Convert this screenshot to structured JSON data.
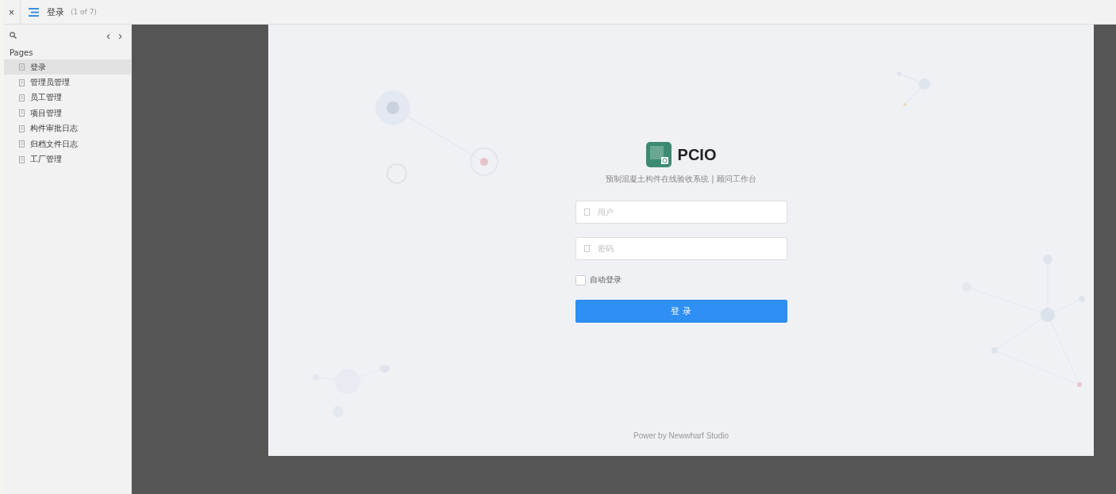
{
  "toolbar": {
    "close": "×",
    "page_title": "登录",
    "page_count": "(1 of 7)"
  },
  "sidebar": {
    "nav_prev": "‹",
    "nav_next": "›",
    "section_title": "Pages",
    "items": [
      {
        "label": "登录",
        "selected": true
      },
      {
        "label": "管理员管理",
        "selected": false
      },
      {
        "label": "员工管理",
        "selected": false
      },
      {
        "label": "项目管理",
        "selected": false
      },
      {
        "label": "构件审批日志",
        "selected": false
      },
      {
        "label": "归档文件日志",
        "selected": false
      },
      {
        "label": "工厂管理",
        "selected": false
      }
    ]
  },
  "login": {
    "app_name": "PCIO",
    "subtitle": "预制混凝土构件在线验收系统 | 顾问工作台",
    "username": {
      "placeholder": "用户"
    },
    "password": {
      "placeholder": "密码"
    },
    "remember": {
      "label": "自动登录",
      "checked": false
    },
    "submit": "登 录",
    "footer": "Power by Newwharf Studio"
  }
}
